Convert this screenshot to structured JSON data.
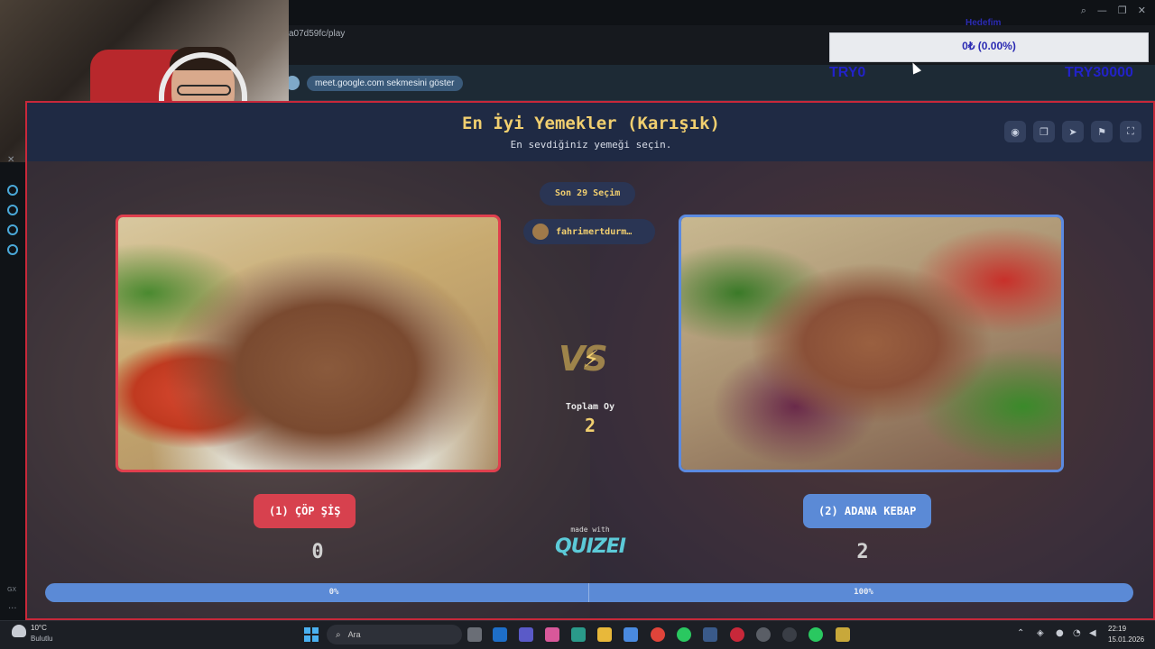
{
  "browser": {
    "url": "a07d59fc/play",
    "infobar_chip": "meet.google.com sekmesini göster"
  },
  "donation": {
    "title": "Hedefim",
    "amount": "0₺ (0.00%)",
    "min": "TRY0",
    "max": "TRY30000",
    "progress_fraction": 0
  },
  "quiz": {
    "title": "En İyi Yemekler (Karışık)",
    "subtitle": "En sevdiğiniz yemeği seçin.",
    "recent_label": "Son 29 Seçim",
    "recent_user": "fahrimertdurm…",
    "vs": "VS",
    "total_label": "Toplam Oy",
    "total_value": "2",
    "made_with": "made with",
    "brand": "QUIZEI",
    "left": {
      "label": "(1) ÇÖP ŞİŞ",
      "votes": "0",
      "percent": "0%",
      "color": "#d7414e"
    },
    "right": {
      "label": "(2) ADANA KEBAP",
      "votes": "2",
      "percent": "100%",
      "color": "#5b8ad6"
    },
    "left_share_fraction": 0,
    "header_icons": [
      "eye-icon",
      "copy-icon",
      "send-icon",
      "flag-icon",
      "fullscreen-icon"
    ]
  },
  "taskbar": {
    "weather_temp": "10°C",
    "weather_desc": "Bulutlu",
    "search_placeholder": "Ara",
    "time": "22:19",
    "date": "15.01.2026"
  },
  "siderail": {
    "gx": "GX",
    "more": "···"
  }
}
